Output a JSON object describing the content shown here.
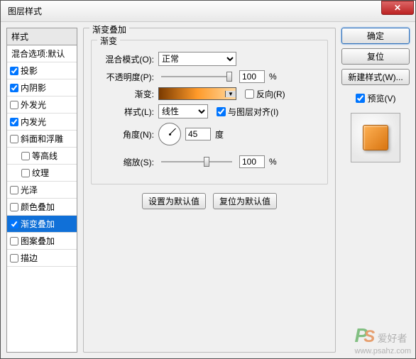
{
  "window": {
    "title": "图层样式"
  },
  "sidebar": {
    "header": "样式",
    "default_label": "混合选项:默认",
    "items": [
      {
        "label": "投影",
        "checked": true,
        "indent": false
      },
      {
        "label": "内阴影",
        "checked": true,
        "indent": false
      },
      {
        "label": "外发光",
        "checked": false,
        "indent": false
      },
      {
        "label": "内发光",
        "checked": true,
        "indent": false
      },
      {
        "label": "斜面和浮雕",
        "checked": false,
        "indent": false
      },
      {
        "label": "等高线",
        "checked": false,
        "indent": true
      },
      {
        "label": "纹理",
        "checked": false,
        "indent": true
      },
      {
        "label": "光泽",
        "checked": false,
        "indent": false
      },
      {
        "label": "颜色叠加",
        "checked": false,
        "indent": false
      },
      {
        "label": "渐变叠加",
        "checked": true,
        "indent": false,
        "selected": true
      },
      {
        "label": "图案叠加",
        "checked": false,
        "indent": false
      },
      {
        "label": "描边",
        "checked": false,
        "indent": false
      }
    ]
  },
  "panel": {
    "title": "渐变叠加",
    "fieldset_title": "渐变",
    "blend_label": "混合模式(O):",
    "blend_value": "正常",
    "opacity_label": "不透明度(P):",
    "opacity_value": "100",
    "percent": "%",
    "gradient_label": "渐变:",
    "reverse_label": "反向(R)",
    "reverse_checked": false,
    "style_label": "样式(L):",
    "style_value": "线性",
    "align_label": "与图层对齐(I)",
    "align_checked": true,
    "angle_label": "角度(N):",
    "angle_value": "45",
    "degree": "度",
    "scale_label": "缩放(S):",
    "scale_value": "100",
    "btn_default": "设置为默认值",
    "btn_reset": "复位为默认值"
  },
  "right": {
    "ok": "确定",
    "cancel": "复位",
    "new_style": "新建样式(W)...",
    "preview_label": "预览(V)",
    "preview_checked": true
  },
  "watermark": {
    "p": "P",
    "s": "S",
    "text": "爱好者",
    "url": "www.psahz.com"
  }
}
